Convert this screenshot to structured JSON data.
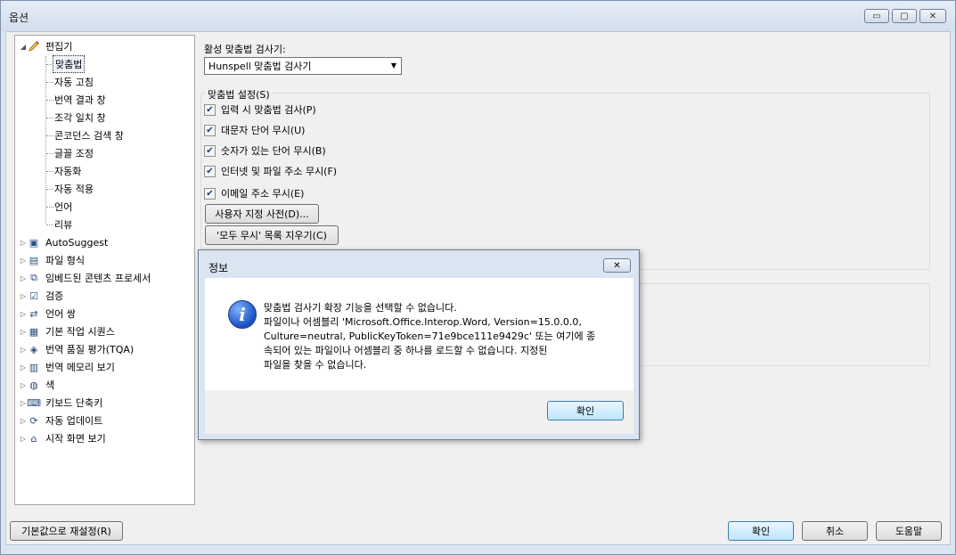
{
  "window": {
    "title": "옵션",
    "min_glyph": "▭",
    "max_glyph": "▢",
    "close_glyph": "✕"
  },
  "tree": {
    "root": {
      "label": "편집기",
      "expander": "◢"
    },
    "children": [
      "맞춤법",
      "자동 고침",
      "번역 결과 창",
      "조각 일치 창",
      "콘코던스 검색 창",
      "글꼴 조정",
      "자동화",
      "자동 적용",
      "언어",
      "리뷰"
    ],
    "selected": "맞춤법",
    "collapsed": [
      {
        "label": "AutoSuggest",
        "icon": "autosuggest-icon"
      },
      {
        "label": "파일 형식",
        "icon": "file-type-icon"
      },
      {
        "label": "임베드된 콘텐츠 프로세서",
        "icon": "embedded-processor-icon"
      },
      {
        "label": "검증",
        "icon": "verification-icon"
      },
      {
        "label": "언어 쌍",
        "icon": "language-pair-icon"
      },
      {
        "label": "기본 작업 시퀀스",
        "icon": "task-sequence-icon"
      },
      {
        "label": "번역 품질 평가(TQA)",
        "icon": "tqa-icon"
      },
      {
        "label": "번역 메모리 보기",
        "icon": "tm-view-icon"
      },
      {
        "label": "색",
        "icon": "color-icon"
      },
      {
        "label": "키보드 단축키",
        "icon": "keyboard-icon"
      },
      {
        "label": "자동 업데이트",
        "icon": "update-icon"
      },
      {
        "label": "시작 화면 보기",
        "icon": "home-icon"
      }
    ],
    "collapsed_expander": "▷"
  },
  "spell": {
    "active_label": "활성 맞춤법 검사기:",
    "checker_value": "Hunspell 맞춤법 검사기",
    "settings_group": "맞춤법 설정(S)",
    "checkboxes": [
      {
        "label": "입력 시 맞춤법 검사(P)",
        "checked": true
      },
      {
        "label": "대문자 단어 무시(U)",
        "checked": true
      },
      {
        "label": "숫자가 있는 단어 무시(B)",
        "checked": true
      },
      {
        "label": "인터넷 및 파일 주소 무시(F)",
        "checked": true
      },
      {
        "label": "이메일 주소 무시(E)",
        "checked": true
      }
    ],
    "check_glyph": "✔",
    "custom_dict_button": "사용자 지정 사전(D)...",
    "clear_ignore_button": "'모두 무시' 목록 지우기(C)"
  },
  "footer": {
    "reset_button": "기본값으로 재설정(R)",
    "ok_button": "확인",
    "cancel_button": "취소",
    "help_button": "도움말"
  },
  "dialog": {
    "title": "정보",
    "close_glyph": "✕",
    "icon_glyph": "i",
    "message_lines": [
      "맞춤법 검사기 확장 기능을 선택할 수 없습니다.",
      "파일이나 어셈블리 'Microsoft.Office.Interop.Word, Version=15.0.0.0,",
      "Culture=neutral, PublicKeyToken=71e9bce111e9429c' 또는 여기에 종",
      "속되어 있는 파일이나 어셈블리 중 하나를 로드할 수 없습니다. 지정된",
      "파일을 찾을 수 없습니다."
    ],
    "ok_button": "확인"
  }
}
